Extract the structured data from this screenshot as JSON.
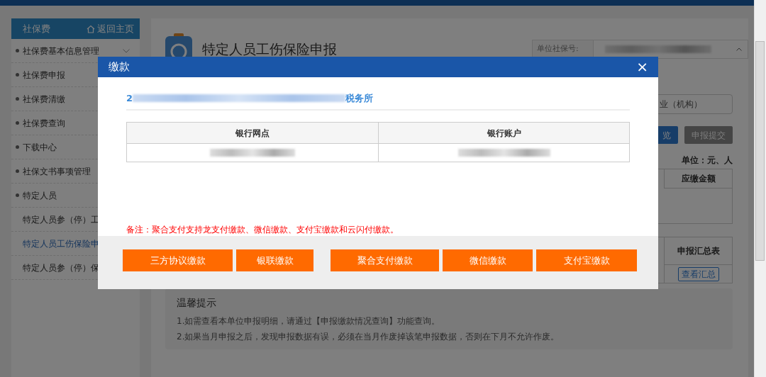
{
  "sidebar": {
    "title": "社保费",
    "home_link": "返回主页",
    "items": [
      {
        "label": "社保费基本信息管理",
        "kind": "collapsible",
        "selected": false
      },
      {
        "label": "社保费申报",
        "kind": "bullet",
        "selected": false
      },
      {
        "label": "社保费清缴",
        "kind": "bullet",
        "selected": false
      },
      {
        "label": "社保费查询",
        "kind": "bullet",
        "selected": false
      },
      {
        "label": "下载中心",
        "kind": "bullet",
        "selected": false
      },
      {
        "label": "社保文书事项管理",
        "kind": "bullet",
        "selected": false
      },
      {
        "label": "特定人员",
        "kind": "bullet",
        "selected": false
      },
      {
        "label": "特定人员参（停）工",
        "kind": "sub",
        "selected": false
      },
      {
        "label": "特定人员工伤保险申",
        "kind": "sub",
        "selected": true
      },
      {
        "label": "特定人员参（停）保",
        "kind": "sub",
        "selected": false
      }
    ]
  },
  "main": {
    "title": "特定人员工伤保险申报",
    "unit_no_label": "单位社保号:",
    "org_type": "业（机构）",
    "buttons": [
      {
        "label": "览",
        "kind": "primary"
      },
      {
        "label": "申报提交",
        "kind": "secondary"
      }
    ],
    "unit": "单位：元、人",
    "table_1": {
      "column": "应缴金额"
    },
    "table_2": {
      "column": "申报汇总表",
      "action": "查看汇总"
    },
    "tips": {
      "title": "温馨提示",
      "lines": [
        "1.如需查看本单位申报明细，请通过【申报缴款情况查询】功能查询。",
        "2.如果当月申报之后，发现申报数据有误，必须在当月作废掉该笔申报数据，否则在下月不允许作废。"
      ]
    }
  },
  "modal": {
    "title": "缴款",
    "close": "×",
    "office_prefix": "2",
    "office_suffix": "税务所",
    "columns": [
      "银行网点",
      "银行账户"
    ],
    "remark": "备注：聚合支付支持龙支付缴款、微信缴款、支付宝缴款和云闪付缴款。",
    "buttons": [
      "三方协议缴款",
      "银联缴款",
      "聚合支付缴款",
      "微信缴款",
      "支付宝缴款"
    ]
  }
}
